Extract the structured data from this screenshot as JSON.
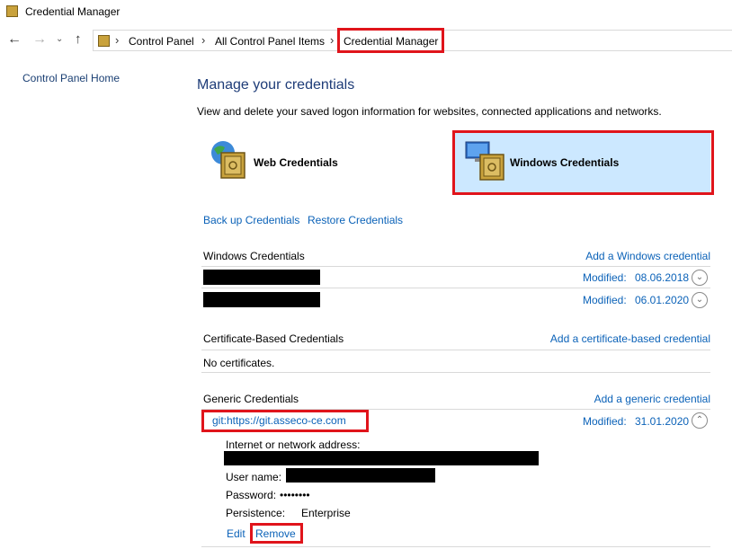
{
  "window": {
    "title": "Credential Manager"
  },
  "nav": {
    "breadcrumb": [
      "Control Panel",
      "All Control Panel Items",
      "Credential Manager"
    ],
    "separator": "›"
  },
  "sidebar": {
    "home_link": "Control Panel Home"
  },
  "main": {
    "heading": "Manage your credentials",
    "description": "View and delete your saved logon information for websites, connected applications and networks.",
    "tiles": [
      {
        "label": "Web Credentials",
        "selected": false
      },
      {
        "label": "Windows Credentials",
        "selected": true
      }
    ],
    "actions": {
      "backup": "Back up Credentials",
      "restore": "Restore Credentials"
    },
    "sections": {
      "windows": {
        "title": "Windows Credentials",
        "add_link": "Add a Windows credential",
        "items": [
          {
            "modified_label": "Modified:",
            "modified_date": "08.06.2018"
          },
          {
            "modified_label": "Modified:",
            "modified_date": "06.01.2020"
          }
        ]
      },
      "certificate": {
        "title": "Certificate-Based Credentials",
        "add_link": "Add a certificate-based credential",
        "empty_text": "No certificates."
      },
      "generic": {
        "title": "Generic Credentials",
        "add_link": "Add a generic credential",
        "item": {
          "name": "git:https://git.asseco-ce.com",
          "modified_label": "Modified:",
          "modified_date": "31.01.2020",
          "address_label": "Internet or network address:",
          "username_label": "User name:",
          "password_label": "Password:",
          "password_value": "••••••••",
          "persistence_label": "Persistence:",
          "persistence_value": "Enterprise",
          "edit_link": "Edit",
          "remove_link": "Remove"
        }
      }
    }
  },
  "colors": {
    "accent": "#0b62b8",
    "highlight": "#e0141b",
    "selected_tile": "#cce8ff"
  }
}
